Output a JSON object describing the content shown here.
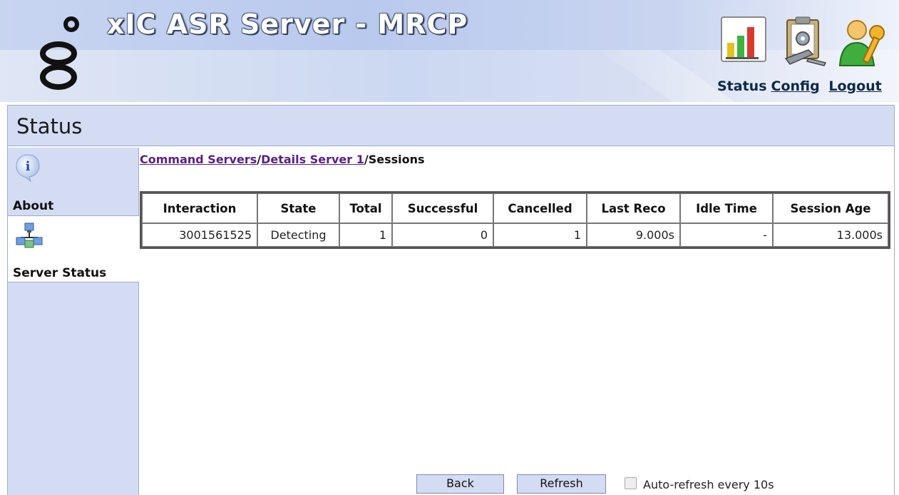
{
  "header": {
    "app_title": "xIC ASR Server - MRCP",
    "nav": {
      "status_label": "Status",
      "config_label": "Config",
      "logout_label": "Logout"
    },
    "icons": [
      "status-chart-icon",
      "config-clipboard-icon",
      "logout-user-key-icon"
    ]
  },
  "page": {
    "title": "Status"
  },
  "sidebar": {
    "items": [
      {
        "label": "About",
        "icon": "info-icon",
        "active": false
      },
      {
        "label": "Server Status",
        "icon": "server-network-icon",
        "active": true
      }
    ]
  },
  "breadcrumb": {
    "crumbs": [
      "Command Servers",
      "Details Server 1",
      "Sessions"
    ],
    "separator": "/"
  },
  "sessions_table": {
    "columns": [
      "Interaction",
      "State",
      "Total",
      "Successful",
      "Cancelled",
      "Last Reco",
      "Idle Time",
      "Session Age"
    ],
    "rows": [
      [
        "3001561525",
        "Detecting",
        "1",
        "0",
        "1",
        "9.000s",
        "-",
        "13.000s"
      ]
    ]
  },
  "controls": {
    "back_label": "Back",
    "refresh_label": "Refresh",
    "auto_refresh_label": "Auto-refresh every 10s",
    "auto_refresh_checked": false
  },
  "colors": {
    "panel_bg": "#d4dcf4",
    "link_visited": "#5a1f86",
    "border": "#9eaad0"
  }
}
